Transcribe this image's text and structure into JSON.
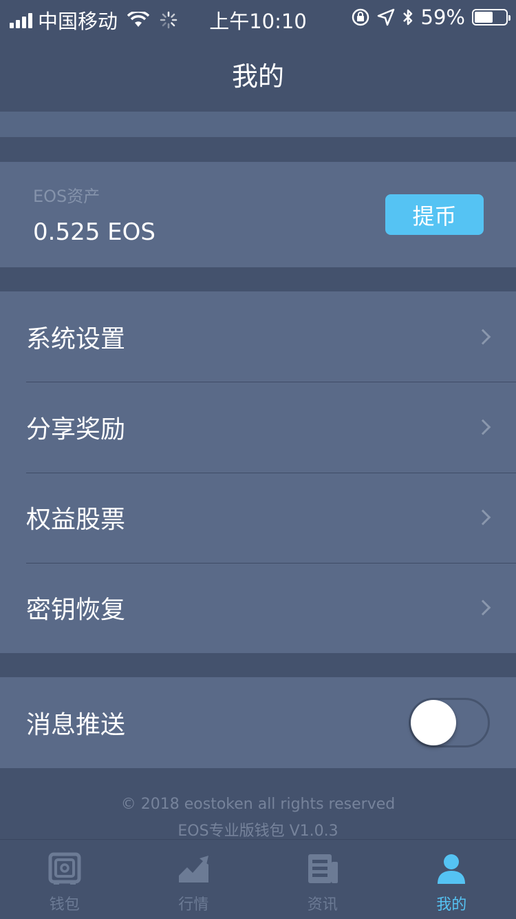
{
  "status_bar": {
    "carrier": "中国移动",
    "time": "上午10:10",
    "battery_percent_text": "59%",
    "battery_level": 0.59
  },
  "nav": {
    "title": "我的"
  },
  "asset": {
    "label": "EOS资产",
    "value": "0.525 EOS",
    "withdraw_label": "提币"
  },
  "menu": {
    "items": [
      {
        "label": "系统设置"
      },
      {
        "label": "分享奖励"
      },
      {
        "label": "权益股票"
      },
      {
        "label": "密钥恢复"
      }
    ]
  },
  "push": {
    "label": "消息推送",
    "enabled": false
  },
  "footer": {
    "copyright": "© 2018 eostoken all rights reserved",
    "version": "EOS专业版钱包 V1.0.3"
  },
  "tabs": [
    {
      "label": "钱包",
      "icon": "wallet-safe-icon",
      "active": false
    },
    {
      "label": "行情",
      "icon": "market-chart-icon",
      "active": false
    },
    {
      "label": "资讯",
      "icon": "news-icon",
      "active": false
    },
    {
      "label": "我的",
      "icon": "profile-icon",
      "active": true
    }
  ],
  "colors": {
    "background": "#44526d",
    "card": "#5a6a88",
    "accent": "#55c3f3",
    "inactive_tab": "#6c7b95"
  }
}
